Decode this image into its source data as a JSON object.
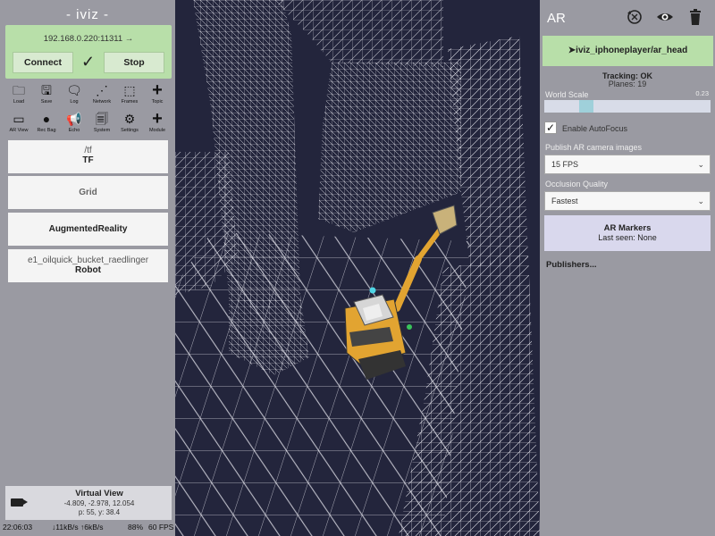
{
  "app": {
    "title": "- iviz -"
  },
  "connection": {
    "uri": "192.168.0.220:11311 →",
    "connect_label": "Connect",
    "stop_label": "Stop",
    "status_icon": "check-icon"
  },
  "toolbar_top": [
    {
      "icon": "folder-icon",
      "glyph": "🗀",
      "label": "Load"
    },
    {
      "icon": "save-icon",
      "glyph": "🖫",
      "label": "Save"
    },
    {
      "icon": "log-icon",
      "glyph": "🗨",
      "label": "Log"
    },
    {
      "icon": "network-icon",
      "glyph": "⋰",
      "label": "Network"
    },
    {
      "icon": "frames-icon",
      "glyph": "⬚",
      "label": "Frames"
    },
    {
      "icon": "plus-icon",
      "glyph": "+",
      "label": "Topic"
    }
  ],
  "toolbar_bottom": [
    {
      "icon": "ar-view-icon",
      "glyph": "▭",
      "label": "AR View"
    },
    {
      "icon": "record-icon",
      "glyph": "●",
      "label": "Rec Bag"
    },
    {
      "icon": "megaphone-icon",
      "glyph": "📢",
      "label": "Echo"
    },
    {
      "icon": "system-icon",
      "glyph": "🗐",
      "label": "System"
    },
    {
      "icon": "gear-icon",
      "glyph": "⚙",
      "label": "Settings"
    },
    {
      "icon": "plus-icon",
      "glyph": "+",
      "label": "Module"
    }
  ],
  "modules": [
    {
      "sub": "/tf",
      "main": "TF"
    },
    {
      "sub": "Grid",
      "main": ""
    },
    {
      "sub": "",
      "main": "AugmentedReality"
    },
    {
      "sub": "e1_oilquick_bucket_raedlinger",
      "main": "Robot"
    }
  ],
  "virtual_view": {
    "title": "Virtual View",
    "position": "-4.809, -2.978, 12.054",
    "orientation": "p: 55, y: 38.4"
  },
  "status_bar": {
    "time": "22:06:03",
    "bandwidth": "↓11kB/s ↑6kB/s",
    "battery": "88%",
    "fps": "60 FPS"
  },
  "ar_panel": {
    "title": "AR",
    "topic": "➤iviz_iphoneplayer/ar_head",
    "tracking": "Tracking: OK",
    "planes": "Planes: 19",
    "world_scale_label": "World Scale",
    "world_scale_value": "0.23",
    "world_scale_fraction": 0.23,
    "autofocus_label": "Enable AutoFocus",
    "autofocus_checked": true,
    "publish_label": "Publish AR camera images",
    "publish_value": "15 FPS",
    "occlusion_label": "Occlusion Quality",
    "occlusion_value": "Fastest",
    "markers_title": "AR Markers",
    "markers_last_seen": "Last seen: None",
    "publishers_label": "Publishers..."
  },
  "colors": {
    "panel_bg": "#9a9aa2",
    "connect_bg": "#b8dfa9",
    "viewport_bg": "#23253c",
    "mesh": "#e8e8f0",
    "robot_body": "#e2a431"
  }
}
